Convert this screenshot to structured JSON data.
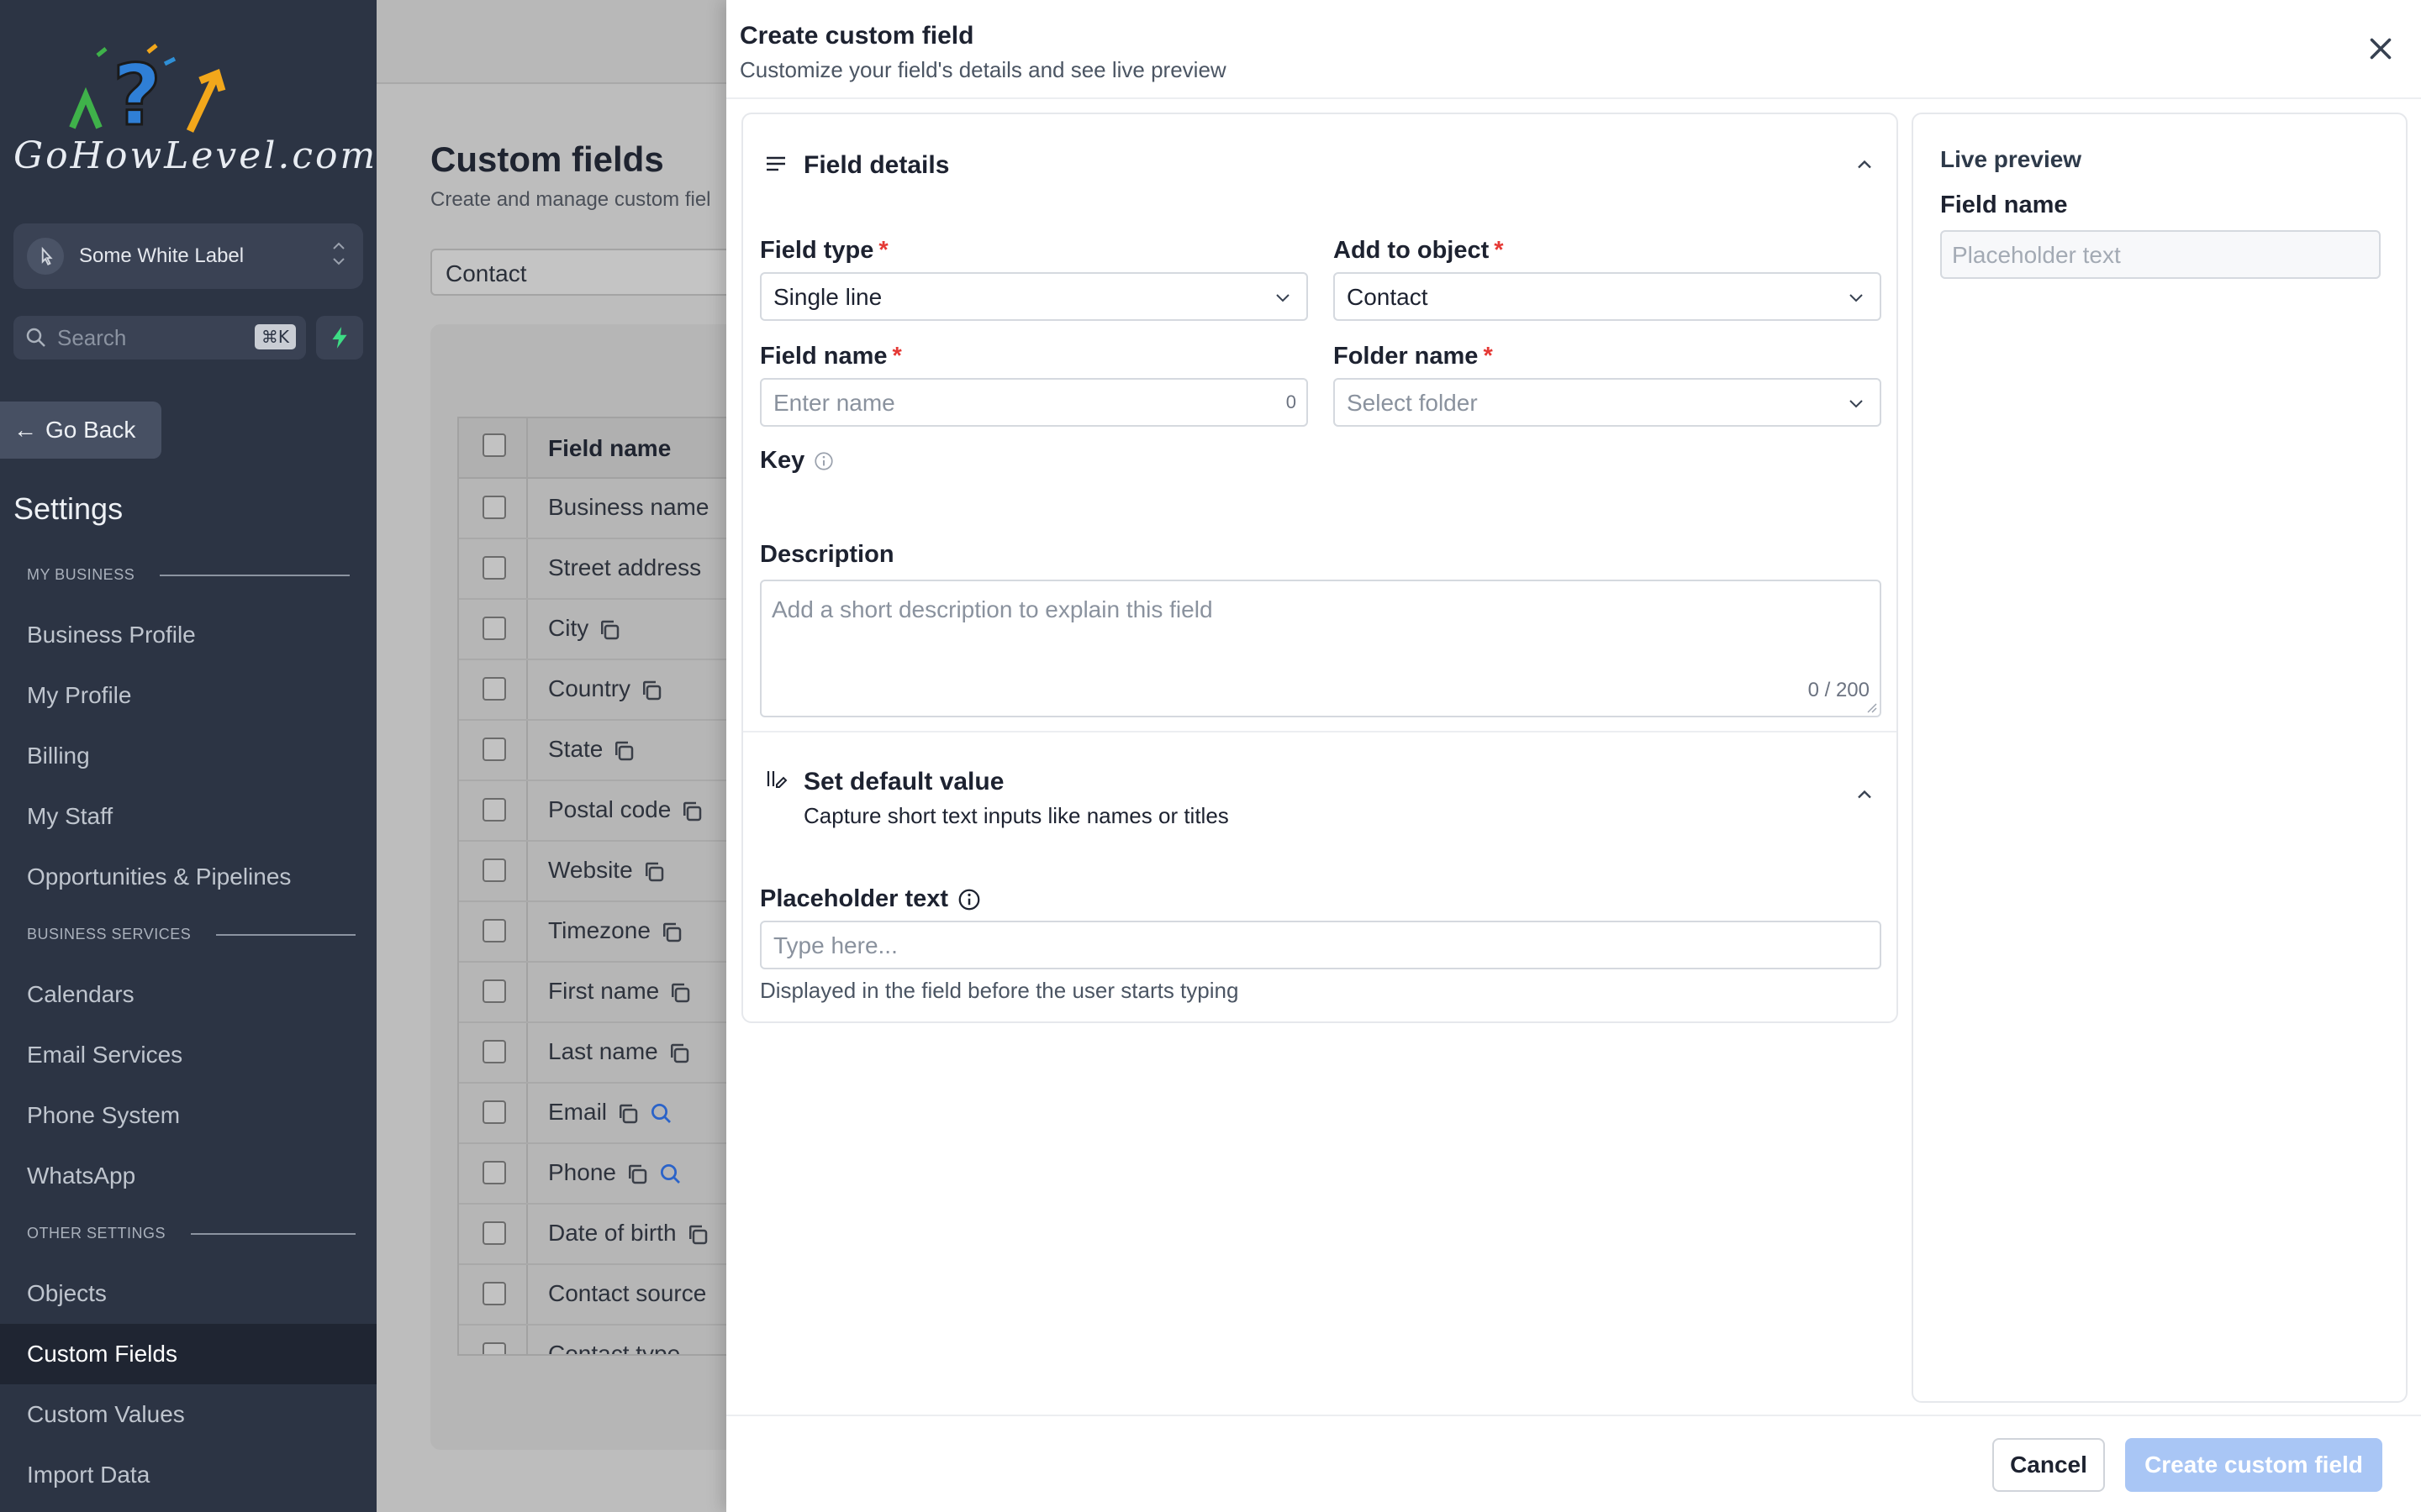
{
  "sidebar": {
    "logo_text": "GoHowLevel.com",
    "account": "Some White Label",
    "search_placeholder": "Search",
    "search_shortcut": "⌘K",
    "go_back": "Go Back",
    "settings_title": "Settings",
    "sections": {
      "my_business": "MY BUSINESS",
      "business_services": "BUSINESS SERVICES",
      "other_settings": "OTHER SETTINGS"
    },
    "items": [
      "Business Profile",
      "My Profile",
      "Billing",
      "My Staff",
      "Opportunities & Pipelines",
      "Calendars",
      "Email Services",
      "Phone System",
      "WhatsApp",
      "Objects",
      "Custom Fields",
      "Custom Values",
      "Import Data"
    ],
    "active_item": "Custom Fields"
  },
  "main": {
    "title": "Custom fields",
    "subtitle": "Create and manage custom fiel",
    "object_select": "Contact",
    "table": {
      "header": "Field name",
      "rows": [
        "Business name",
        "Street address",
        "City",
        "Country",
        "State",
        "Postal code",
        "Website",
        "Timezone",
        "First name",
        "Last name",
        "Email",
        "Phone",
        "Date of birth",
        "Contact source",
        "Contact type"
      ]
    }
  },
  "drawer": {
    "title": "Create custom field",
    "subtitle": "Customize your field's details and see live preview",
    "field_details": {
      "title": "Field details",
      "field_type_label": "Field type",
      "field_type_value": "Single line",
      "add_to_object_label": "Add to object",
      "add_to_object_value": "Contact",
      "field_name_label": "Field name",
      "field_name_placeholder": "Enter name",
      "field_name_count": "0",
      "folder_name_label": "Folder name",
      "folder_name_placeholder": "Select folder",
      "key_label": "Key",
      "description_label": "Description",
      "description_placeholder": "Add a short description to explain this field",
      "description_count": "0 / 200",
      "required_mark": "*"
    },
    "default_value": {
      "title": "Set default value",
      "subtitle": "Capture short text inputs like names or titles",
      "placeholder_label": "Placeholder text",
      "placeholder_input": "Type here...",
      "help": "Displayed in the field before the user starts typing"
    },
    "preview": {
      "title": "Live preview",
      "field_label": "Field name",
      "placeholder": "Placeholder text"
    },
    "buttons": {
      "cancel": "Cancel",
      "create": "Create custom field"
    }
  }
}
